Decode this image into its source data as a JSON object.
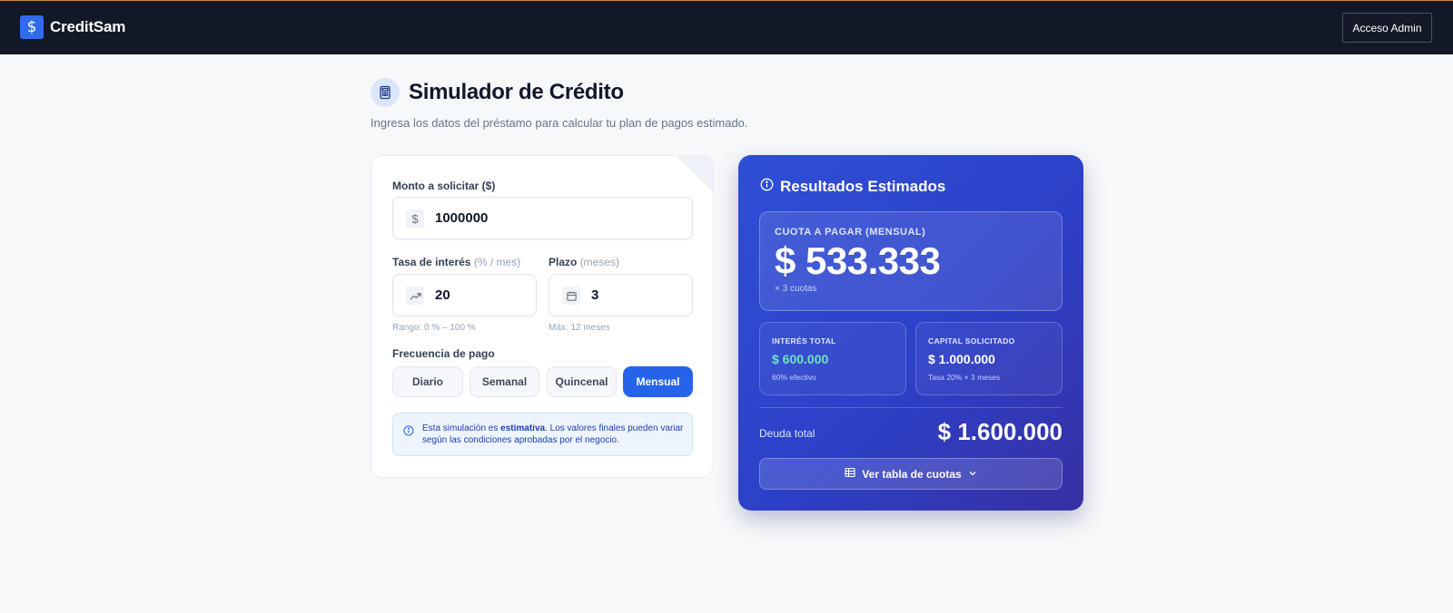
{
  "header": {
    "brand_name": "CreditSam",
    "brand_symbol": "$",
    "admin_button": "Acceso Admin"
  },
  "page": {
    "title": "Simulador de Crédito",
    "subtitle": "Ingresa los datos del préstamo para calcular tu plan de pagos estimado."
  },
  "form": {
    "amount": {
      "label": "Monto a solicitar ($)",
      "value": "1000000",
      "icon": "dollar-icon"
    },
    "rate": {
      "label": "Tasa de interés",
      "unit": "(% / mes)",
      "value": "20",
      "hint": "Rango: 0 % – 100 %",
      "icon": "trending-up-icon"
    },
    "term": {
      "label": "Plazo",
      "unit": "(meses)",
      "value": "3",
      "hint": "Máx: 12 meses",
      "icon": "calendar-icon"
    },
    "frequency": {
      "label": "Frecuencia de pago",
      "options": [
        "Diario",
        "Semanal",
        "Quincenal",
        "Mensual"
      ],
      "selected": "Mensual"
    },
    "note": {
      "prefix": "Esta simulación es ",
      "bold": "estimativa",
      "suffix": ". Los valores finales pueden variar según las condiciones aprobadas por el negocio."
    }
  },
  "results": {
    "title": "Resultados Estimados",
    "quota": {
      "label": "CUOTA A PAGAR (MENSUAL)",
      "value": "$ 533.333",
      "sub": "× 3 cuotas"
    },
    "interest": {
      "label": "INTERÉS TOTAL",
      "value": "$ 600.000",
      "sub": "60% efectivo"
    },
    "capital": {
      "label": "CAPITAL SOLICITADO",
      "value": "$ 1.000.000",
      "sub": "Tasa 20% × 3 meses"
    },
    "debt": {
      "label": "Deuda total",
      "value": "$ 1.600.000"
    },
    "table_button": "Ver tabla de cuotas"
  },
  "colors": {
    "accent": "#2563eb",
    "topbar": "#121826",
    "result_card": "#2d40c8",
    "interest_green": "#6ee7b7"
  }
}
